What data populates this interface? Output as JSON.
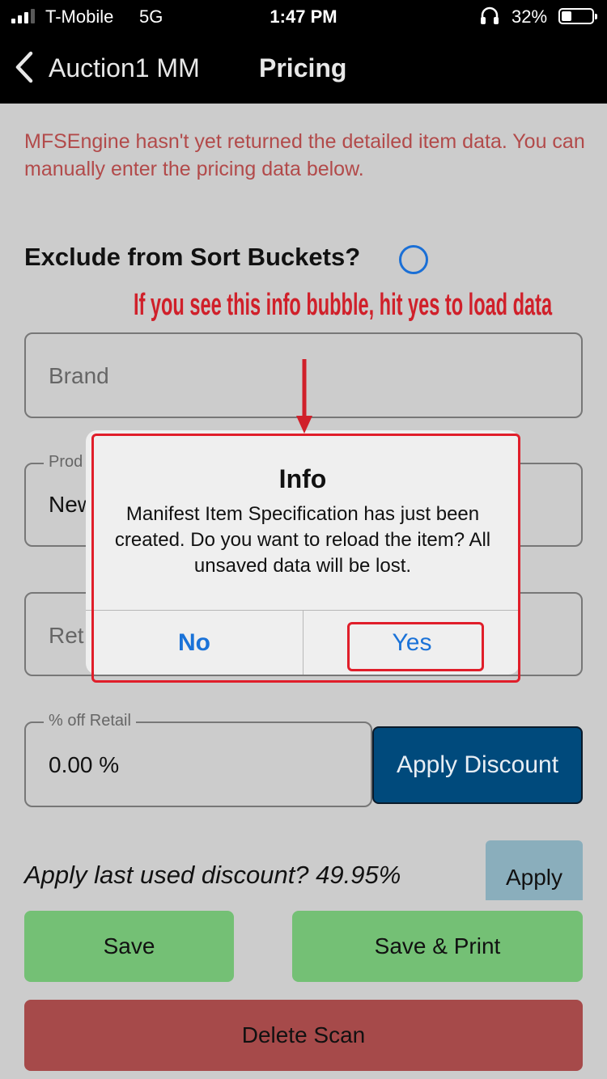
{
  "status_bar": {
    "carrier": "T-Mobile",
    "network": "5G",
    "time": "1:47 PM",
    "battery_percent": "32%",
    "battery_level": 0.32
  },
  "nav": {
    "back_label": "Auction1 MM",
    "title": "Pricing"
  },
  "warning_text": "MFSEngine hasn't yet returned the detailed item data. You can manually enter the pricing data below.",
  "exclude": {
    "label": "Exclude from Sort Buckets?",
    "checked": false
  },
  "annotation_text": "If you see this info bubble, hit yes to load data",
  "fields": {
    "brand": {
      "placeholder": "Brand"
    },
    "product": {
      "legend": "Prod",
      "value": "New"
    },
    "retail": {
      "placeholder": "Ret"
    },
    "percent_off": {
      "legend": "% off Retail",
      "value": "0.00 %"
    }
  },
  "apply_discount_label": "Apply Discount",
  "last_discount": {
    "text": "Apply last used discount? 49.95%",
    "apply_label": "Apply"
  },
  "buttons": {
    "save": "Save",
    "save_print": "Save & Print",
    "delete": "Delete Scan"
  },
  "dialog": {
    "title": "Info",
    "message": "Manifest Item Specification has just been created. Do you want to reload the item? All unsaved data will be lost.",
    "no_label": "No",
    "yes_label": "Yes"
  },
  "colors": {
    "header_bg": "#000000",
    "page_bg": "#cccccc",
    "warning": "#b24a4a",
    "accent_blue": "#1a72d8",
    "apply_discount_bg": "#004a7c",
    "save_green": "#74c075",
    "delete_red": "#a64a4a",
    "annotation_red": "#e01e2a"
  }
}
